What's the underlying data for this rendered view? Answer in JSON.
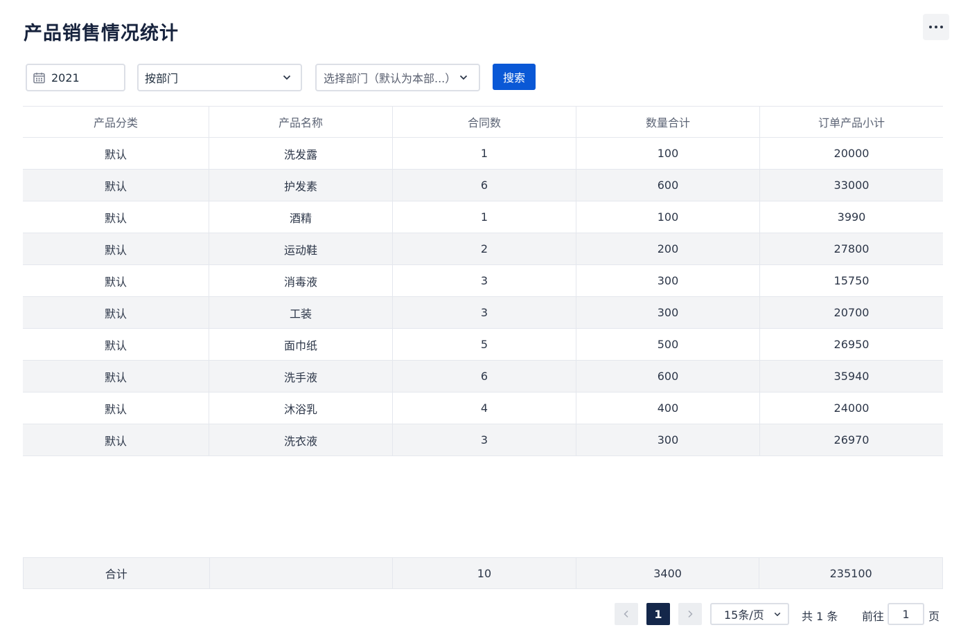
{
  "title": "产品销售情况统计",
  "filters": {
    "year": "2021",
    "dept_mode": "按部门",
    "dept_placeholder": "选择部门（默认为本部...）",
    "search_label": "搜索"
  },
  "table": {
    "columns": [
      "产品分类",
      "产品名称",
      "合同数",
      "数量合计",
      "订单产品小计"
    ],
    "rows": [
      [
        "默认",
        "洗发露",
        "1",
        "100",
        "20000"
      ],
      [
        "默认",
        "护发素",
        "6",
        "600",
        "33000"
      ],
      [
        "默认",
        "酒精",
        "1",
        "100",
        "3990"
      ],
      [
        "默认",
        "运动鞋",
        "2",
        "200",
        "27800"
      ],
      [
        "默认",
        "消毒液",
        "3",
        "300",
        "15750"
      ],
      [
        "默认",
        "工装",
        "3",
        "300",
        "20700"
      ],
      [
        "默认",
        "面巾纸",
        "5",
        "500",
        "26950"
      ],
      [
        "默认",
        "洗手液",
        "6",
        "600",
        "35940"
      ],
      [
        "默认",
        "沐浴乳",
        "4",
        "400",
        "24000"
      ],
      [
        "默认",
        "洗衣液",
        "3",
        "300",
        "26970"
      ]
    ],
    "summary": [
      "合计",
      "",
      "10",
      "3400",
      "235100"
    ]
  },
  "pagination": {
    "current_page": "1",
    "page_size": "15条/页",
    "total": "共 1 条",
    "goto_label": "前往",
    "goto_value": "1",
    "page_suffix": "页"
  }
}
